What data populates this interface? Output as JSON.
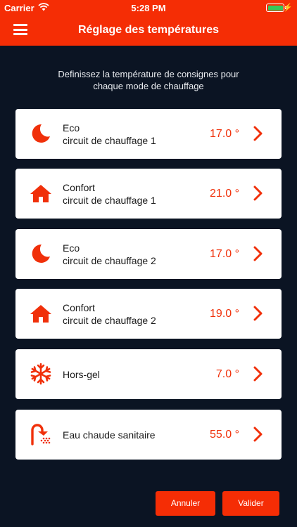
{
  "status_bar": {
    "carrier": "Carrier",
    "time": "5:28 PM"
  },
  "header": {
    "title": "Réglage des températures"
  },
  "intro": {
    "line1": "Definissez la température de consignes pour",
    "line2": "chaque mode de chauffage"
  },
  "modes": [
    {
      "icon": "moon-icon",
      "name": "Eco",
      "circuit": "circuit de chauffage 1",
      "value": "17.0 °"
    },
    {
      "icon": "home-icon",
      "name": "Confort",
      "circuit": "circuit de chauffage 1",
      "value": "21.0 °"
    },
    {
      "icon": "moon-icon",
      "name": "Eco",
      "circuit": "circuit de chauffage 2",
      "value": "17.0 °"
    },
    {
      "icon": "home-icon",
      "name": "Confort",
      "circuit": "circuit de chauffage 2",
      "value": "19.0 °"
    },
    {
      "icon": "snowflake-icon",
      "name": "Hors-gel",
      "value": "7.0 °"
    },
    {
      "icon": "shower-icon",
      "name": "Eau chaude sanitaire",
      "value": "55.0 °"
    }
  ],
  "actions": {
    "cancel_label": "Annuler",
    "validate_label": "Valider"
  },
  "colors": {
    "accent": "#f52d05",
    "background": "#0b1423",
    "card": "#ffffff",
    "battery": "#35c759"
  }
}
